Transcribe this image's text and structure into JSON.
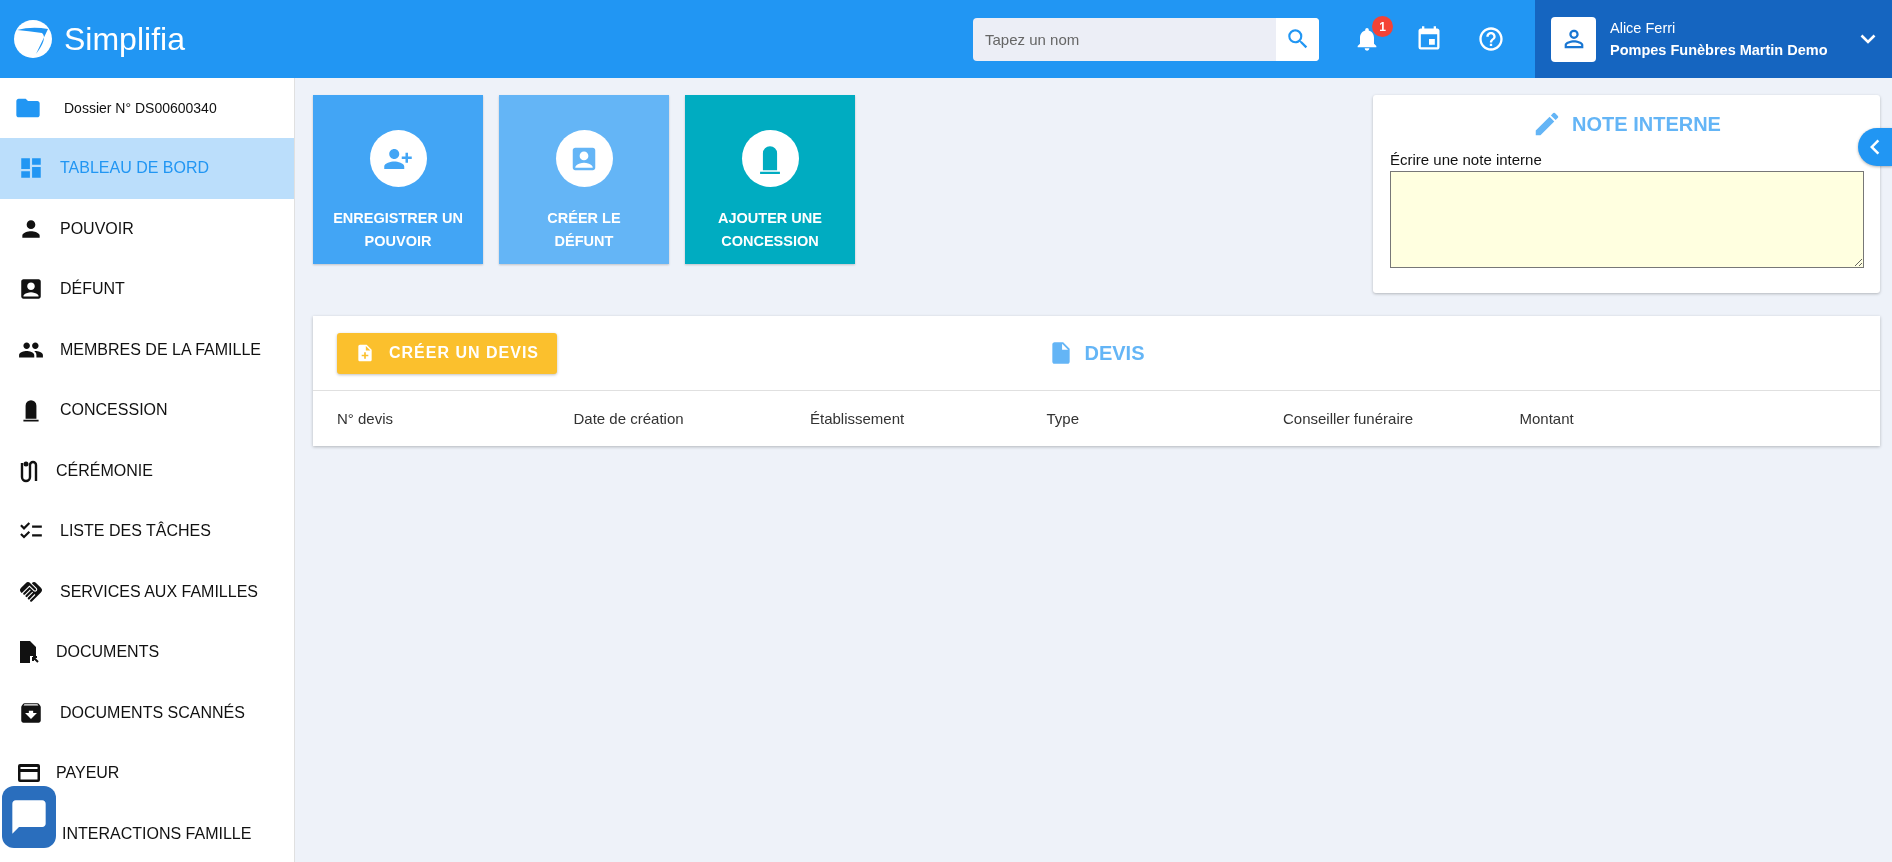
{
  "header": {
    "brand": "Simplifia",
    "search": {
      "placeholder": "Tapez un nom"
    },
    "notifications": {
      "count": "1"
    },
    "user": {
      "name": "Alice Ferri",
      "company": "Pompes Funèbres Martin Demo"
    }
  },
  "sidebar": {
    "dossier": "Dossier N° DS00600340",
    "items": [
      {
        "label": "TABLEAU DE BORD",
        "selected": true
      },
      {
        "label": "POUVOIR",
        "selected": false
      },
      {
        "label": "DÉFUNT",
        "selected": false
      },
      {
        "label": "MEMBRES DE LA FAMILLE",
        "selected": false
      },
      {
        "label": "CONCESSION",
        "selected": false
      },
      {
        "label": "CÉRÉMONIE",
        "selected": false
      },
      {
        "label": "LISTE DES TÂCHES",
        "selected": false
      },
      {
        "label": "SERVICES AUX FAMILLES",
        "selected": false
      },
      {
        "label": "DOCUMENTS",
        "selected": false
      },
      {
        "label": "DOCUMENTS SCANNÉS",
        "selected": false
      },
      {
        "label": "PAYEUR",
        "selected": false
      },
      {
        "label": "INTERACTIONS FAMILLE",
        "selected": false
      }
    ]
  },
  "actions": [
    {
      "label": "ENREGISTRER UN POUVOIR",
      "color": "#42a5f5"
    },
    {
      "label": "CRÉER LE DÉFUNT",
      "color": "#64b5f6"
    },
    {
      "label": "AJOUTER UNE CONCESSION",
      "color": "#00acc1"
    }
  ],
  "note": {
    "title": "NOTE INTERNE",
    "label": "Écrire une note interne"
  },
  "devis": {
    "button": "CRÉER UN DEVIS",
    "title": "DEVIS",
    "columns": [
      "N° devis",
      "Date de création",
      "Établissement",
      "Type",
      "Conseiller funéraire",
      "Montant"
    ]
  }
}
